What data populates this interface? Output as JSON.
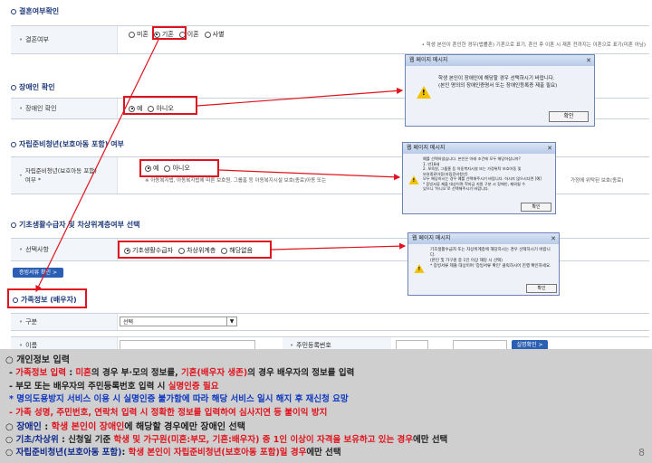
{
  "marriage": {
    "title": "결혼여부확인",
    "label": "결혼여부",
    "options": [
      "미혼",
      "기혼",
      "이혼",
      "사별"
    ],
    "selected": "기혼",
    "hint": "• 학생 본인이 혼인한 경우(법률혼) 기혼으로 표기, 혼인 후 이혼 시 재혼 전까지는 이혼으로 표기(미혼 아님)"
  },
  "disability": {
    "title": "장애인 확인",
    "label": "장애인 확인",
    "options": [
      "예",
      "아니오"
    ],
    "selected": "예",
    "dialog": {
      "title": "웹 페이지 메시지",
      "message": "학생 본인이 장애인에 해당할 경우 선택하시기 바랍니다.\n(본인 명의의 장애인증명서 또는 장애인등록증 제출 필요)",
      "ok": "확인"
    }
  },
  "independent": {
    "title": "자립준비청년(보호아동 포함) 여부",
    "label": "자립준비청년(보호아동 포함)\n여부 *",
    "options": [
      "예",
      "아니오"
    ],
    "selected": "예",
    "desc_left": "※ 아동복지법, 아동복지법에 따른 보호원, 그룹홈 등 아동복지시설 보호(종료)아동 또는",
    "desc_right": "가정에 위탁된 보호(종료)",
    "dialog": {
      "title": "웹 페이지 메시지",
      "message": "예를 선택하셨습니다. 본인은 아래 조건에 모두 해당하십니까?\n1. 만18세\n2. 보육원, 그룹홈 등 아동복지시설 또는 가정위탁 보호아동 및\n보호종료아동(자립준비청년)\n모두 해당하시는 경우 예를 선택해주시기 바랍니다. 하시지 않으시다면 [예]\n* 증빙서류 제출 대상이며 학자금 지원 구분 시 장애인, 제외될 수\n있으니 '아니오'로 선택해주시기 바랍니다.",
      "ok": "확인"
    }
  },
  "basic": {
    "title": "기초생활수급자 및 차상위계층여부 선택",
    "label": "선택사항",
    "options": [
      "기초생활수급자",
      "차상위계층",
      "해당없음"
    ],
    "selected": "기초생활수급자",
    "verify_button": "증빙서류 확인 >",
    "dialog": {
      "title": "웹 페이지 메시지",
      "message": "기초생활수급자 또는 차상위계층에 해당하시는 경우 선택하시기 바랍니다.\n(본인 및 가구원 중 1인 이상 해당 시 선택)\n* 증빙서류 제출 대상이며 '증빙서류 확인' 클릭하시어 진행 확인하세요.",
      "ok": "확인"
    }
  },
  "family": {
    "title": "가족정보 (배우자)",
    "relation_label": "구분",
    "relation_value": "선택",
    "name_label": "이름",
    "rrn_label": "주민등록번호",
    "auth_button": "실명확인 >"
  },
  "notes": {
    "l1": "○ 개인정보 입력",
    "l2a": " - ",
    "l2b": "가족정보 입력",
    "l2c": " : ",
    "l2d": "미혼",
    "l2e": "의 경우 부·모의 정보를, ",
    "l2f": "기혼(배우자 생존)",
    "l2g": "의 경우 배우자의 정보를 입력",
    "l3a": " - 부모 또는 배우자의 주민등록번호 입력 시 ",
    "l3b": "실명인증 필요",
    "l4": "   * 명의도용방지 서비스 이용 시 실명인증 불가함에 따라 해당 서비스 일시 해지 후 재신청 요망",
    "l5": " - 가족 성명, 주민번호, 연락처 입력 시 정확한 정보를 입력하여 심사지연 등 불이익 방지",
    "l6a": "○ ",
    "l6b": "장애인",
    "l6c": " : ",
    "l6d": "학생 본인이 장애인",
    "l6e": "에 해당할 경우에만 장애인 선택",
    "l7a": "○ ",
    "l7b": "기초/차상위",
    "l7c": " : 신청일 기준 ",
    "l7d": "학생 및 가구원(미혼:부모, 기혼:배우자) 중 1인 이상이 자격을 보유하고 있는 경우",
    "l7e": "에만 선택",
    "l8a": "○ ",
    "l8b": "자립준비청년(보호아동 포함)",
    "l8c": ": ",
    "l8d": "학생 본인이 자립준비청년(보호아동 포함)일 경우",
    "l8e": "에만 선택"
  },
  "page_number": "8"
}
